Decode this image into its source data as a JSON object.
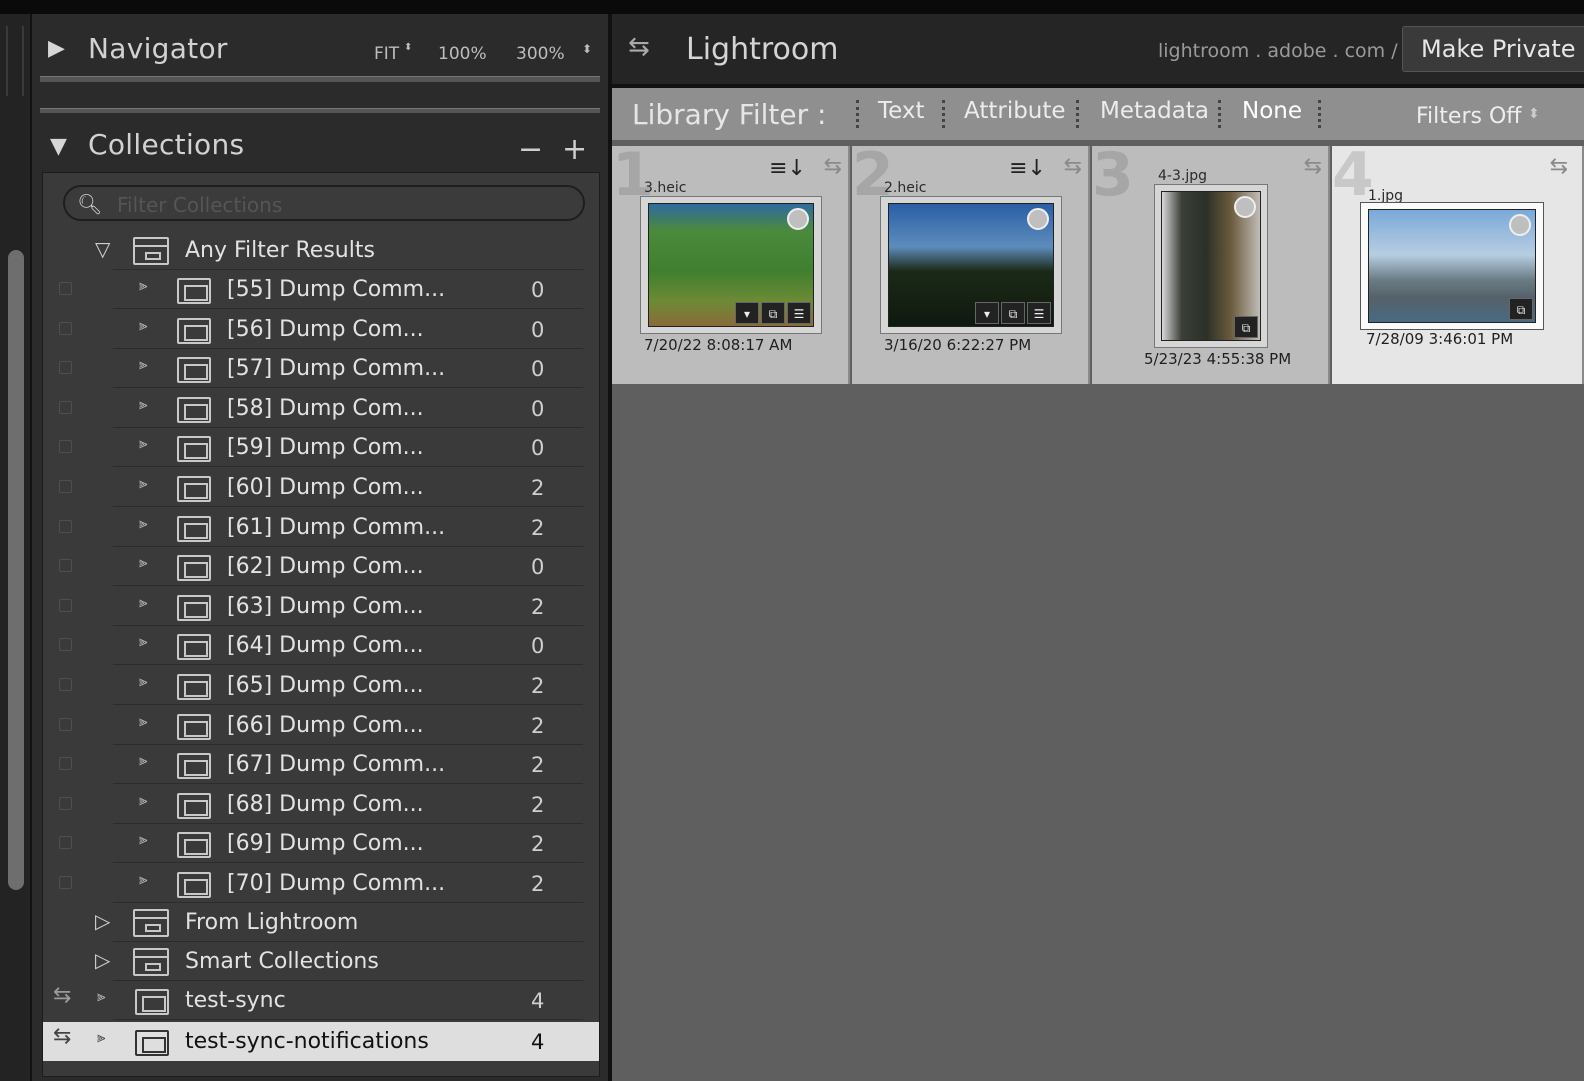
{
  "navigator": {
    "title": "Navigator",
    "zoom_fit": "FIT",
    "zoom_100": "100%",
    "zoom_300": "300%"
  },
  "collections": {
    "title": "Collections",
    "remove_label": "−",
    "add_label": "+",
    "filter_placeholder": "Filter Collections",
    "any_filter_label": "Any Filter Results",
    "items": [
      {
        "label": "[55] Dump Comm...",
        "count": "0"
      },
      {
        "label": "[56] Dump Com...",
        "count": "0"
      },
      {
        "label": "[57] Dump Comm...",
        "count": "0"
      },
      {
        "label": "[58] Dump Com...",
        "count": "0"
      },
      {
        "label": "[59] Dump Com...",
        "count": "0"
      },
      {
        "label": "[60] Dump Com...",
        "count": "2"
      },
      {
        "label": "[61] Dump Comm...",
        "count": "2"
      },
      {
        "label": "[62] Dump Com...",
        "count": "0"
      },
      {
        "label": "[63] Dump Com...",
        "count": "2"
      },
      {
        "label": "[64] Dump Com...",
        "count": "0"
      },
      {
        "label": "[65] Dump Com...",
        "count": "2"
      },
      {
        "label": "[66] Dump Com...",
        "count": "2"
      },
      {
        "label": "[67] Dump Comm...",
        "count": "2"
      },
      {
        "label": "[68] Dump Com...",
        "count": "2"
      },
      {
        "label": "[69] Dump Com...",
        "count": "2"
      },
      {
        "label": "[70] Dump Comm...",
        "count": "2"
      }
    ],
    "from_lightroom_label": "From Lightroom",
    "smart_collections_label": "Smart Collections",
    "test_sync_label": "test-sync",
    "test_sync_count": "4",
    "test_sync_notifications_label": "test-sync-notifications",
    "test_sync_notifications_count": "4"
  },
  "identity": {
    "app": "Lightroom",
    "url": "lightroom . adobe . com /",
    "make_private": "Make Private"
  },
  "library_filter": {
    "label": "Library Filter :",
    "text": "Text",
    "attribute": "Attribute",
    "metadata": "Metadata",
    "none": "None",
    "filters_off": "Filters Off"
  },
  "grid": [
    {
      "index": "1",
      "file": "3.heic",
      "date": "7/20/22 8:08:17 AM"
    },
    {
      "index": "2",
      "file": "2.heic",
      "date": "3/16/20 6:22:27 PM"
    },
    {
      "index": "3",
      "file": "4-3.jpg",
      "date": "5/23/23 4:55:38 PM"
    },
    {
      "index": "4",
      "file": "1.jpg",
      "date": "7/28/09 3:46:01 PM"
    }
  ],
  "colors": {
    "panel_bg": "#2b2b2b",
    "collections_bg": "#3a3a3a",
    "grid_bg": "#5f5f5f",
    "filter_bar_bg": "#8f8f8f",
    "selected_row_bg": "#dedede"
  }
}
